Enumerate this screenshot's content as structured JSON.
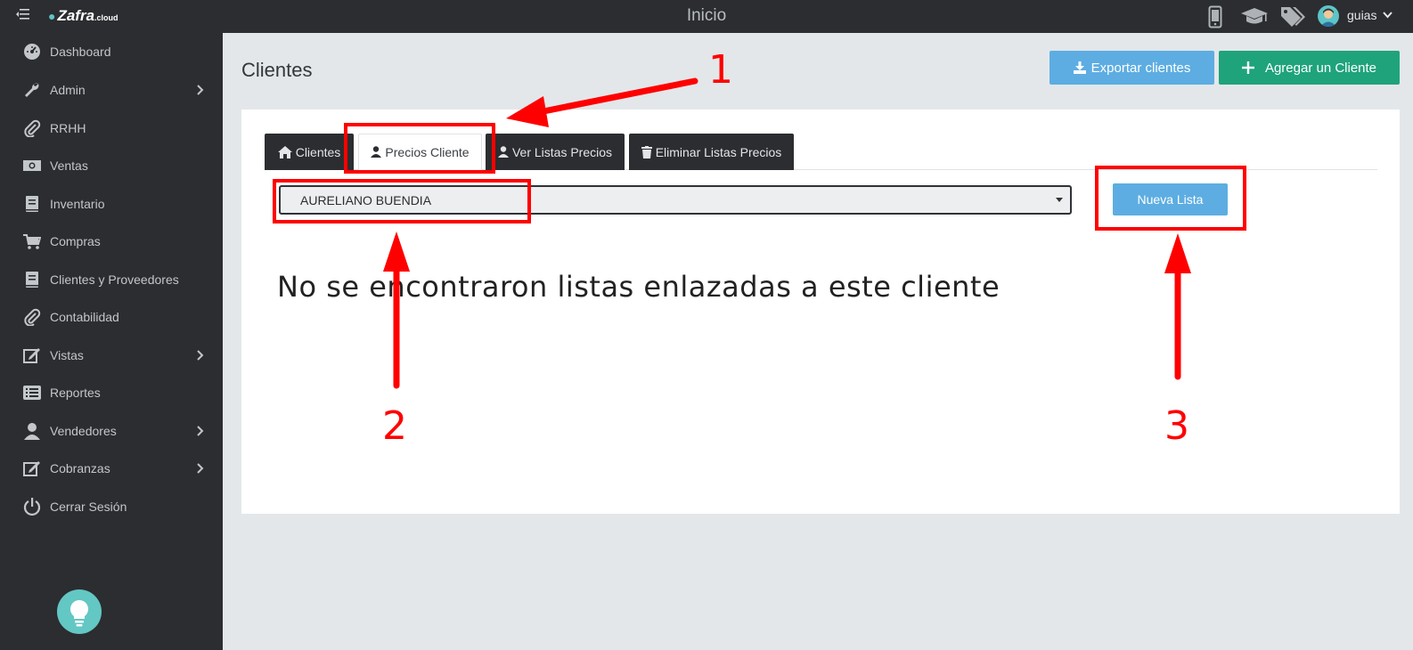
{
  "topbar": {
    "logo_text": "Zafra",
    "logo_suffix": ".cloud",
    "title": "Inicio",
    "icons": [
      "mobile-icon",
      "graduation-cap-icon",
      "tags-icon"
    ],
    "user_name": "guias"
  },
  "sidebar": {
    "items": [
      {
        "label": "Dashboard",
        "icon": "dashboard-icon",
        "submenu": false
      },
      {
        "label": "Admin",
        "icon": "wrench-icon",
        "submenu": true
      },
      {
        "label": "RRHH",
        "icon": "paperclip-icon",
        "submenu": false
      },
      {
        "label": "Ventas",
        "icon": "money-icon",
        "submenu": false
      },
      {
        "label": "Inventario",
        "icon": "book-icon",
        "submenu": false
      },
      {
        "label": "Compras",
        "icon": "cart-icon",
        "submenu": false
      },
      {
        "label": "Clientes y Proveedores",
        "icon": "book-icon",
        "submenu": false
      },
      {
        "label": "Contabilidad",
        "icon": "paperclip-icon",
        "submenu": false
      },
      {
        "label": "Vistas",
        "icon": "edit-icon",
        "submenu": true
      },
      {
        "label": "Reportes",
        "icon": "list-icon",
        "submenu": false
      },
      {
        "label": "Vendedores",
        "icon": "user-icon",
        "submenu": true
      },
      {
        "label": "Cobranzas",
        "icon": "edit-icon",
        "submenu": true
      },
      {
        "label": "Cerrar Sesión",
        "icon": "power-icon",
        "submenu": false
      }
    ],
    "help_icon": "lightbulb-icon"
  },
  "main": {
    "title": "Clientes",
    "export_label": "Exportar clientes",
    "add_label": "Agregar un Cliente",
    "tabs": [
      {
        "label": "Clientes",
        "icon": "home-icon",
        "active": false
      },
      {
        "label": "Precios Cliente",
        "icon": "user-icon",
        "active": true
      },
      {
        "label": "Ver Listas Precios",
        "icon": "user-icon",
        "active": false
      },
      {
        "label": "Eliminar Listas Precios",
        "icon": "trash-icon",
        "active": false
      }
    ],
    "client_select_value": "AURELIANO BUENDIA",
    "new_list_label": "Nueva Lista",
    "empty_message": "No se encontraron listas enlazadas a este cliente"
  },
  "annotations": {
    "labels": [
      "1",
      "2",
      "3"
    ],
    "color": "#ff0000"
  },
  "colors": {
    "dark": "#2b2d30",
    "primary_blue": "#5dade2",
    "success_green": "#1fa37b",
    "teal": "#5ec4c7",
    "background": "#e3e7ea"
  }
}
